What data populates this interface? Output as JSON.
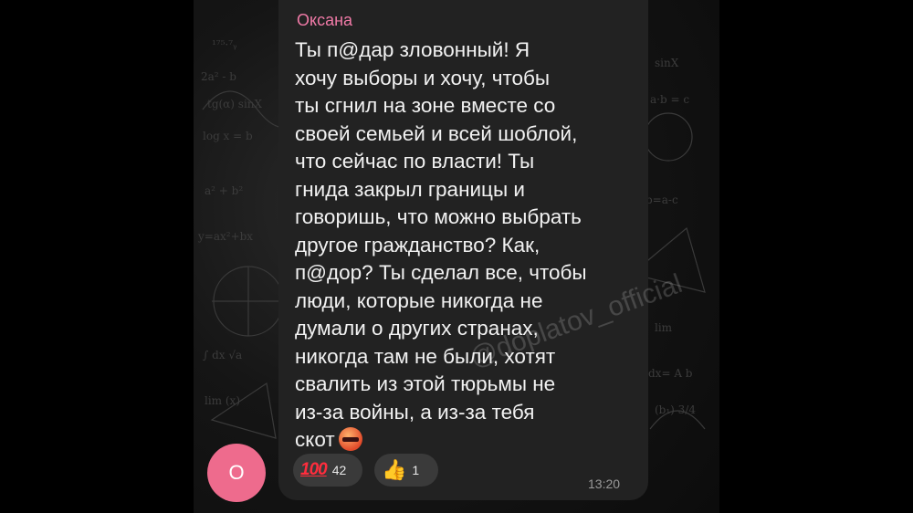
{
  "message": {
    "sender": "Оксана",
    "text": "Ты п@дар зловонный! Я\nхочу выборы и хочу, чтобы\nты сгнил на зоне вместе со\nсвоей семьей и всей шоблой,\nчто сейчас по власти! Ты\nгнида закрыл границы и\nговоришь, что можно выбрать\nдругое гражданство? Как,\nп@дор? Ты сделал все, чтобы\nлюди, которые никогда не\nдумали о других странах,\nникогда там не были, хотят\nсвалить из этой тюрьмы не\nиз-за войны, а из-за тебя\nскот",
    "end_emoji": "angry-face-icon",
    "time": "13:20"
  },
  "reactions": [
    {
      "icon": "hundred-points-icon",
      "glyph": "100",
      "count": "42"
    },
    {
      "icon": "thumbs-up-icon",
      "glyph": "👍",
      "count": "1"
    }
  ],
  "avatar": {
    "letter": "О",
    "color": "#ee6b8d"
  },
  "watermark": "@doplatov_official",
  "colors": {
    "sender": "#f07aa7",
    "bubble": "#222222",
    "background": "#000000"
  }
}
